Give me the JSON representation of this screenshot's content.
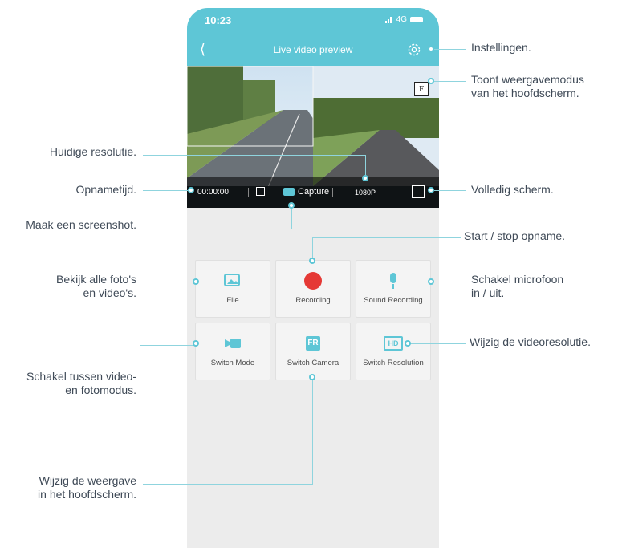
{
  "status_bar": {
    "time": "10:23",
    "network": "4G"
  },
  "header": {
    "title": "Live video preview"
  },
  "video_bar": {
    "rec_time": "00:00:00",
    "capture_label": "Capture",
    "resolution": "1080P",
    "mode_badge": "F"
  },
  "tiles": [
    {
      "label": "File",
      "icon": "image-gallery-icon"
    },
    {
      "label": "Recording",
      "icon": "record-dot-icon"
    },
    {
      "label": "Sound Recording",
      "icon": "microphone-icon"
    },
    {
      "label": "Switch Mode",
      "icon": "video-camera-icon"
    },
    {
      "label": "Switch Camera",
      "icon": "front-rear-icon",
      "icon_text": "FR"
    },
    {
      "label": "Switch Resolution",
      "icon": "hd-icon",
      "icon_text": "HD"
    }
  ],
  "annotations": {
    "settings": "Instellingen.",
    "display_mode": [
      "Toont weergavemodus",
      "van het hoofdscherm."
    ],
    "current_resolution": "Huidige resolutie.",
    "recording_time": "Opnametijd.",
    "fullscreen": "Volledig scherm.",
    "screenshot": "Maak een screenshot.",
    "start_stop": "Start / stop opname.",
    "view_files": [
      "Bekijk alle foto's",
      "en video's."
    ],
    "microphone": [
      "Schakel microfoon",
      "in / uit."
    ],
    "change_resolution": "Wijzig de videoresolutie.",
    "switch_mode": [
      "Schakel tussen video-",
      "en fotomodus."
    ],
    "change_view": [
      "Wijzig de weergave",
      "in het hoofdscherm."
    ]
  },
  "colors": {
    "accent": "#5ec6d6",
    "record_red": "#e53935",
    "annotation_text": "#3f4a57"
  }
}
